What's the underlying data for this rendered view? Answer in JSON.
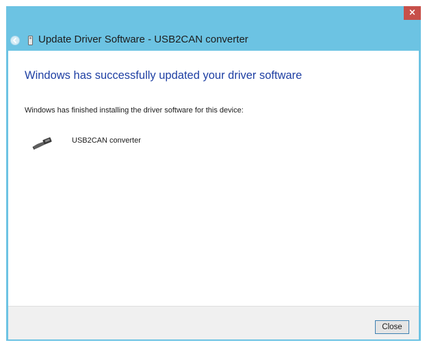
{
  "window": {
    "close_glyph": "×",
    "accent_color": "#6cc3e3",
    "close_color": "#c7504a"
  },
  "nav": {
    "back_icon": "back-arrow-icon",
    "device_icon": "usb-device-icon",
    "title": "Update Driver Software - USB2CAN converter"
  },
  "content": {
    "heading": "Windows has successfully updated your driver software",
    "description": "Windows has finished installing the driver software for this device:",
    "device_icon": "usb-plug-icon",
    "device_name": "USB2CAN converter",
    "heading_color": "#1e3fa3"
  },
  "footer": {
    "close_label": "Close"
  }
}
